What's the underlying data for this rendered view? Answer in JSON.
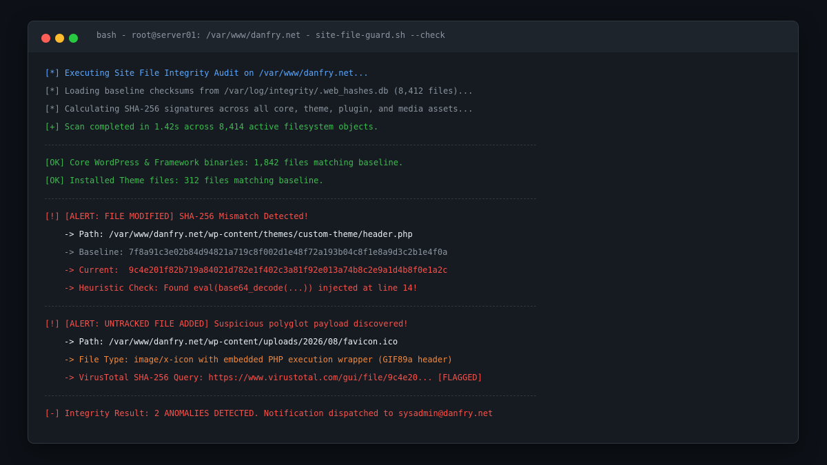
{
  "window": {
    "title": "bash - root@server01: /var/www/danfry.net - site-file-guard.sh --check"
  },
  "colors": {
    "info": "#58a6ff",
    "muted": "#8b949e",
    "success": "#3fb950",
    "alert": "#f85149",
    "path": "#e6edf3",
    "warning": "#f0883e"
  },
  "terminal": {
    "lines": [
      {
        "kind": "text",
        "text": "[*] Executing Site File Integrity Audit on /var/www/danfry.net...",
        "color": "blue",
        "indent": false,
        "name": "audit-start-line"
      },
      {
        "kind": "text",
        "text": "[*] Loading baseline checksums from /var/log/integrity/.web_hashes.db (8,412 files)...",
        "color": "gray",
        "indent": false,
        "name": "baseline-load-line"
      },
      {
        "kind": "text",
        "text": "[*] Calculating SHA-256 signatures across all core, theme, plugin, and media assets...",
        "color": "gray",
        "indent": false,
        "name": "hash-calc-line"
      },
      {
        "kind": "text",
        "text": "[+] Scan completed in 1.42s across 8,414 active filesystem objects.",
        "color": "green",
        "indent": false,
        "name": "scan-complete-line"
      },
      {
        "kind": "divider"
      },
      {
        "kind": "text",
        "text": "[OK] Core WordPress & Framework binaries: 1,842 files matching baseline.",
        "color": "green",
        "indent": false,
        "name": "core-ok-line"
      },
      {
        "kind": "text",
        "text": "[OK] Installed Theme files: 312 files matching baseline.",
        "color": "green",
        "indent": false,
        "name": "theme-ok-line"
      },
      {
        "kind": "divider"
      },
      {
        "kind": "text",
        "text": "[!] [ALERT: FILE MODIFIED] SHA-256 Mismatch Detected!",
        "color": "red",
        "indent": false,
        "name": "alert-modified-line"
      },
      {
        "kind": "text",
        "text": "-> Path: /var/www/danfry.net/wp-content/themes/custom-theme/header.php",
        "color": "white",
        "indent": true,
        "name": "modified-path-line"
      },
      {
        "kind": "text",
        "text": "-> Baseline: 7f8a91c3e02b84d94821a719c8f002d1e48f72a193b04c8f1e8a9d3c2b1e4f0a",
        "color": "gray",
        "indent": true,
        "name": "baseline-hash-line"
      },
      {
        "kind": "text",
        "text": "-> Current:  9c4e201f82b719a84021d782e1f402c3a81f92e013a74b8c2e9a1d4b8f0e1a2c",
        "color": "red",
        "indent": true,
        "name": "current-hash-line"
      },
      {
        "kind": "text",
        "text": "-> Heuristic Check: Found eval(base64_decode(...)) injected at line 14!",
        "color": "red",
        "indent": true,
        "name": "heuristic-line"
      },
      {
        "kind": "divider"
      },
      {
        "kind": "text",
        "text": "[!] [ALERT: UNTRACKED FILE ADDED] Suspicious polyglot payload discovered!",
        "color": "red",
        "indent": false,
        "name": "alert-added-line"
      },
      {
        "kind": "text",
        "text": "-> Path: /var/www/danfry.net/wp-content/uploads/2026/08/favicon.ico",
        "color": "white",
        "indent": true,
        "name": "added-path-line"
      },
      {
        "kind": "text",
        "text": "-> File Type: image/x-icon with embedded PHP execution wrapper (GIF89a header)",
        "color": "orange",
        "indent": true,
        "name": "file-type-line"
      },
      {
        "kind": "text",
        "text": "-> VirusTotal SHA-256 Query: https://www.virustotal.com/gui/file/9c4e20... [FLAGGED]",
        "color": "red",
        "indent": true,
        "name": "virustotal-line"
      },
      {
        "kind": "divider"
      },
      {
        "kind": "text",
        "text": "[-] Integrity Result: 2 ANOMALIES DETECTED. Notification dispatched to sysadmin@danfry.net",
        "color": "red",
        "indent": false,
        "name": "integrity-result-line"
      }
    ]
  }
}
